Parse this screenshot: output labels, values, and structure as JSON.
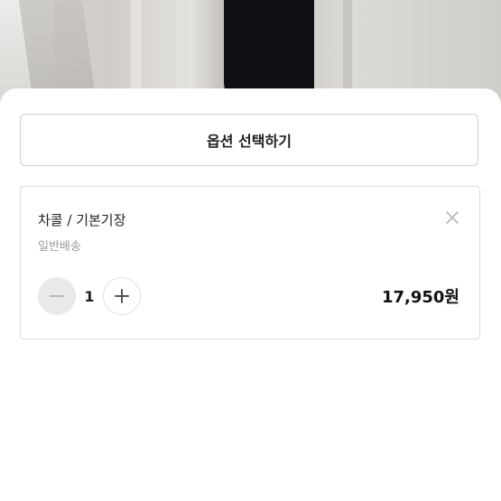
{
  "option_select": {
    "label": "옵션 선택하기"
  },
  "selected_option": {
    "name": "차콜 / 기본기장",
    "shipping": "일반배송",
    "quantity": "1",
    "price": "17,950원"
  },
  "icons": {
    "remove": "close-icon",
    "decrease": "minus-icon",
    "increase": "plus-icon"
  },
  "colors": {
    "text_primary": "#222222",
    "text_secondary": "#9a9a9a",
    "border": "#dcdcdc",
    "minus_button_bg": "#e9e9e9"
  }
}
